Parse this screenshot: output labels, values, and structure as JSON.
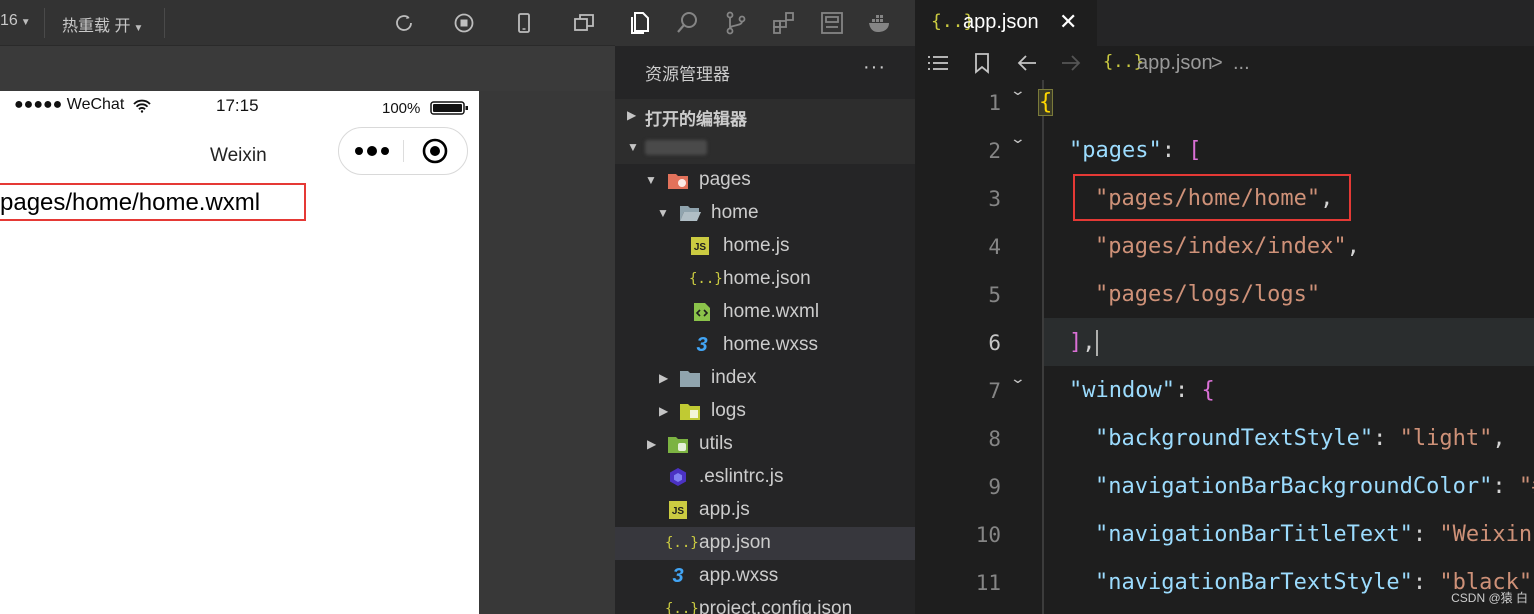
{
  "simulator": {
    "toolbar": {
      "version_text": "16",
      "hot_reload": "热重载 开"
    },
    "status": {
      "signal": "●●●●● WeChat",
      "time": "17:15",
      "battery": "100%"
    },
    "nav_title": "Weixin",
    "page_text": "pages/home/home.wxml"
  },
  "explorer": {
    "header": "资源管理器",
    "more": "···",
    "open_editors": "打开的编辑器",
    "tree": [
      {
        "label": "pages",
        "icon": "pages-folder-icon"
      },
      {
        "label": "home",
        "icon": "folder-open-icon"
      },
      {
        "label": "home.js",
        "icon": "js-file-icon"
      },
      {
        "label": "home.json",
        "icon": "json-file-icon"
      },
      {
        "label": "home.wxml",
        "icon": "wxml-file-icon"
      },
      {
        "label": "home.wxss",
        "icon": "css-file-icon"
      },
      {
        "label": "index",
        "icon": "folder-icon"
      },
      {
        "label": "logs",
        "icon": "logs-folder-icon"
      },
      {
        "label": "utils",
        "icon": "utils-folder-icon"
      },
      {
        "label": ".eslintrc.js",
        "icon": "eslint-icon"
      },
      {
        "label": "app.js",
        "icon": "js-file-icon"
      },
      {
        "label": "app.json",
        "icon": "json-file-icon"
      },
      {
        "label": "app.wxss",
        "icon": "css-file-icon"
      },
      {
        "label": "project.config.json",
        "icon": "json-file-icon"
      }
    ]
  },
  "editor": {
    "tab": {
      "icon": "{..}",
      "name": "app.json",
      "close": "✕"
    },
    "breadcrumb": {
      "icon": "{..}",
      "file": "app.json",
      "sep": ">",
      "more": "..."
    },
    "line_numbers": [
      "1",
      "2",
      "3",
      "4",
      "5",
      "6",
      "7",
      "8",
      "9",
      "10",
      "11"
    ],
    "lines": {
      "l1": "{",
      "l2_key": "\"pages\"",
      "l2_rest": ": ",
      "l2_bracket": "[",
      "l3": "\"pages/home/home\"",
      "l4": "\"pages/index/index\"",
      "l5": "\"pages/logs/logs\"",
      "l6_bracket": "]",
      "l7_key": "\"window\"",
      "l7_brace": "{",
      "l8_key": "\"backgroundTextStyle\"",
      "l8_val": "\"light\"",
      "l9_key": "\"navigationBarBackgroundColor\"",
      "l9_val": "\"#",
      "l10_key": "\"navigationBarTitleText\"",
      "l10_val": "\"Weixin\"",
      "l11_key": "\"navigationBarTextStyle\"",
      "l11_val": "\"black\"",
      "comma": ",",
      "colon": ": "
    }
  },
  "watermark": "CSDN @猿 白"
}
